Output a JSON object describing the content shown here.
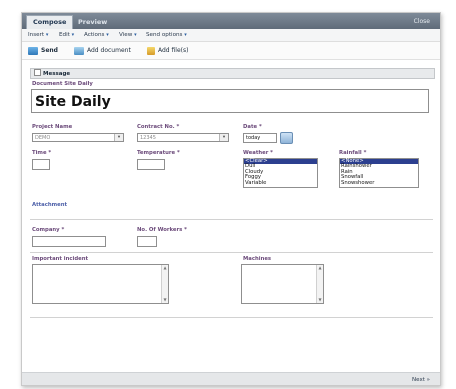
{
  "tabs": {
    "compose": "Compose",
    "preview": "Preview",
    "close": "Close"
  },
  "menu": [
    {
      "label": "Insert"
    },
    {
      "label": "Edit"
    },
    {
      "label": "Actions"
    },
    {
      "label": "View"
    },
    {
      "label": "Send options"
    }
  ],
  "toolbar": {
    "send": "Send",
    "add_document": "Add document",
    "add_files": "Add file(s)"
  },
  "section": {
    "message": "Message"
  },
  "document": {
    "label": "Document Site Daily",
    "title": "Site Daily"
  },
  "fields": {
    "project_name": {
      "label": "Project Name",
      "value": "DEMO"
    },
    "contract_no": {
      "label": "Contract No. *",
      "value": "12345"
    },
    "date": {
      "label": "Date *",
      "value": "today"
    },
    "time": {
      "label": "Time *"
    },
    "temperature": {
      "label": "Temperature *"
    },
    "weather": {
      "label": "Weather *",
      "options": [
        "<Clear>",
        "Dull",
        "Cloudy",
        "Foggy",
        "Variable"
      ],
      "selected": "<Clear>"
    },
    "rainfall": {
      "label": "Rainfall *",
      "options": [
        "<None>",
        "Rainshower",
        "Rain",
        "Snowfall",
        "Snowshower"
      ],
      "selected": "<None>"
    },
    "attachment": {
      "label": "Attachment"
    },
    "company": {
      "label": "Company *"
    },
    "workers": {
      "label": "No. Of Workers *"
    },
    "incident": {
      "label": "Important incident"
    },
    "machines": {
      "label": "Machines"
    }
  },
  "footer": {
    "next": "Next"
  },
  "colors": {
    "title_bar": "#5f6b79",
    "label_purple": "#6b4a7a",
    "label_blue": "#4c5fa8",
    "selection": "#2c3f8f"
  },
  "icons": [
    "send-icon",
    "add-document-icon",
    "add-files-icon",
    "calendar-icon",
    "chevron-down-icon"
  ]
}
